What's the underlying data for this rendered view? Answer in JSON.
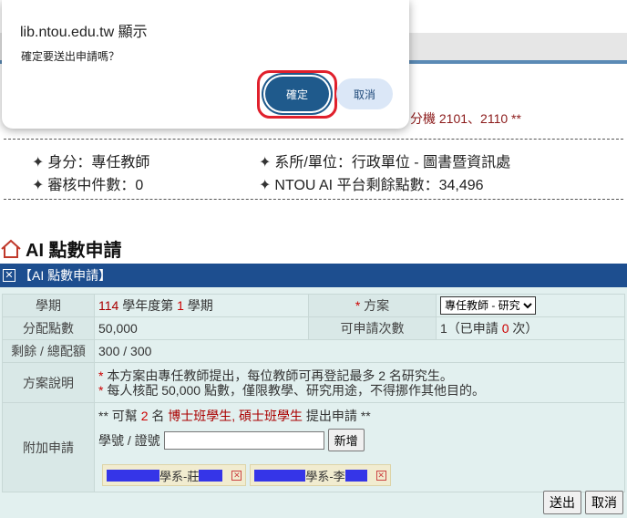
{
  "dialog": {
    "title": "lib.ntou.edu.tw 顯示",
    "message": "確定要送出申請嗎？",
    "ok_label": "確定",
    "cancel_label": "取消"
  },
  "background": {
    "extension_text": "分機 2101、2110 **",
    "info": {
      "identity": "身分：專任教師",
      "dept": "系所/單位：行政單位 - 圖書暨資訊處",
      "review_count": "審核中件數：0",
      "remaining_points": "NTOU AI 平台剩餘點數：34,496"
    },
    "section_title": "AI 點數申請",
    "panel_title": "【AI 點數申請】",
    "form": {
      "term_label": "學期",
      "term_year": "114",
      "term_mid": " 學年度第 ",
      "term_num": "1",
      "term_end": " 學期",
      "plan_label": "方案",
      "plan_star": "* ",
      "plan_value": "專任教師 - 研究",
      "points_label": "分配點數",
      "points_value": "50,000",
      "apply_times_label": "可申請次數",
      "apply_times_pre": "1（已申請 ",
      "apply_times_count": "0",
      "apply_times_post": " 次）",
      "remain_label": "剩餘 / 總配額",
      "remain_value": "300 / 300",
      "desc_label": "方案說明",
      "desc_line1": "本方案由專任教師提出，每位教師可再登記最多 2 名研究生。",
      "desc_line2": "每人核配 50,000 點數，僅限教學、研究用途，不得挪作其他目的。",
      "attach_label": "附加申請",
      "attach_note_pre": "** 可幫 ",
      "attach_note_num": "2",
      "attach_note_mid": " 名 ",
      "attach_note_who": "博士班學生, 碩士班學生",
      "attach_note_post": " 提出申請 **",
      "student_id_label": "學號 / 證號",
      "student_id_value": "",
      "add_button": "新增",
      "chips": [
        {
          "text": "學系-莊"
        },
        {
          "text": "學系-李"
        }
      ]
    },
    "submit_button": "送出",
    "cancel_button": "取消"
  }
}
